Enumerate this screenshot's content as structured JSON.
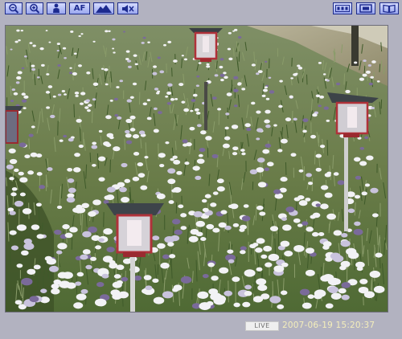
{
  "toolbar": {
    "left_buttons": [
      {
        "icon": "zoom-out-icon"
      },
      {
        "icon": "zoom-in-icon"
      },
      {
        "icon": "person-icon"
      },
      {
        "icon": "autofocus-icon",
        "label": "AF"
      },
      {
        "icon": "landscape-icon"
      },
      {
        "icon": "speaker-mute-icon"
      }
    ],
    "right_buttons": [
      {
        "icon": "image-size-icon"
      },
      {
        "icon": "screen-icon"
      },
      {
        "icon": "book-icon"
      }
    ]
  },
  "status": {
    "live_label": "LIVE",
    "timestamp": "2007-06-19 15:20:37"
  },
  "colors": {
    "background": "#b2b2c0",
    "button_border": "#1f2d8a",
    "timestamp_text": "#f4eebb"
  }
}
